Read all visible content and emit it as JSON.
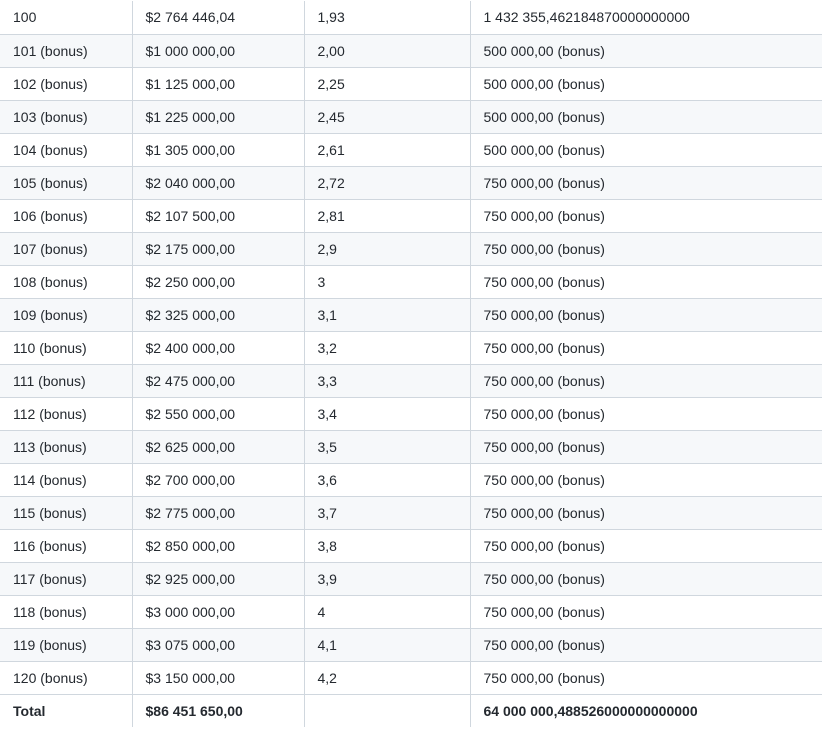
{
  "table": {
    "rows": [
      [
        "100",
        "$2 764 446,04",
        "1,93",
        "1 432 355,462184870000000000"
      ],
      [
        "101 (bonus)",
        "$1 000 000,00",
        "2,00",
        "500 000,00 (bonus)"
      ],
      [
        "102 (bonus)",
        "$1 125 000,00",
        "2,25",
        "500 000,00 (bonus)"
      ],
      [
        "103 (bonus)",
        "$1 225 000,00",
        "2,45",
        "500 000,00 (bonus)"
      ],
      [
        "104 (bonus)",
        "$1 305 000,00",
        "2,61",
        "500 000,00 (bonus)"
      ],
      [
        "105 (bonus)",
        "$2 040 000,00",
        "2,72",
        "750 000,00 (bonus)"
      ],
      [
        "106 (bonus)",
        "$2 107 500,00",
        "2,81",
        "750 000,00 (bonus)"
      ],
      [
        "107 (bonus)",
        "$2 175 000,00",
        "2,9",
        "750 000,00 (bonus)"
      ],
      [
        "108 (bonus)",
        "$2 250 000,00",
        "3",
        "750 000,00 (bonus)"
      ],
      [
        "109 (bonus)",
        "$2 325 000,00",
        "3,1",
        "750 000,00 (bonus)"
      ],
      [
        "110 (bonus)",
        "$2 400 000,00",
        "3,2",
        "750 000,00 (bonus)"
      ],
      [
        "111 (bonus)",
        "$2 475 000,00",
        "3,3",
        "750 000,00 (bonus)"
      ],
      [
        "112 (bonus)",
        "$2 550 000,00",
        "3,4",
        "750 000,00 (bonus)"
      ],
      [
        "113 (bonus)",
        "$2 625 000,00",
        "3,5",
        "750 000,00 (bonus)"
      ],
      [
        "114 (bonus)",
        "$2 700 000,00",
        "3,6",
        "750 000,00 (bonus)"
      ],
      [
        "115 (bonus)",
        "$2 775 000,00",
        "3,7",
        "750 000,00 (bonus)"
      ],
      [
        "116 (bonus)",
        "$2 850 000,00",
        "3,8",
        "750 000,00 (bonus)"
      ],
      [
        "117 (bonus)",
        "$2 925 000,00",
        "3,9",
        "750 000,00 (bonus)"
      ],
      [
        "118 (bonus)",
        "$3 000 000,00",
        "4",
        "750 000,00 (bonus)"
      ],
      [
        "119 (bonus)",
        "$3 075 000,00",
        "4,1",
        "750 000,00 (bonus)"
      ],
      [
        "120 (bonus)",
        "$3 150 000,00",
        "4,2",
        "750 000,00 (bonus)"
      ]
    ],
    "total": [
      "Total",
      "$86 451 650,00",
      "",
      "64 000 000,488526000000000000"
    ]
  },
  "colors": {
    "border": "#d0d7de",
    "stripe": "#f6f8fa",
    "text": "#24292f"
  }
}
